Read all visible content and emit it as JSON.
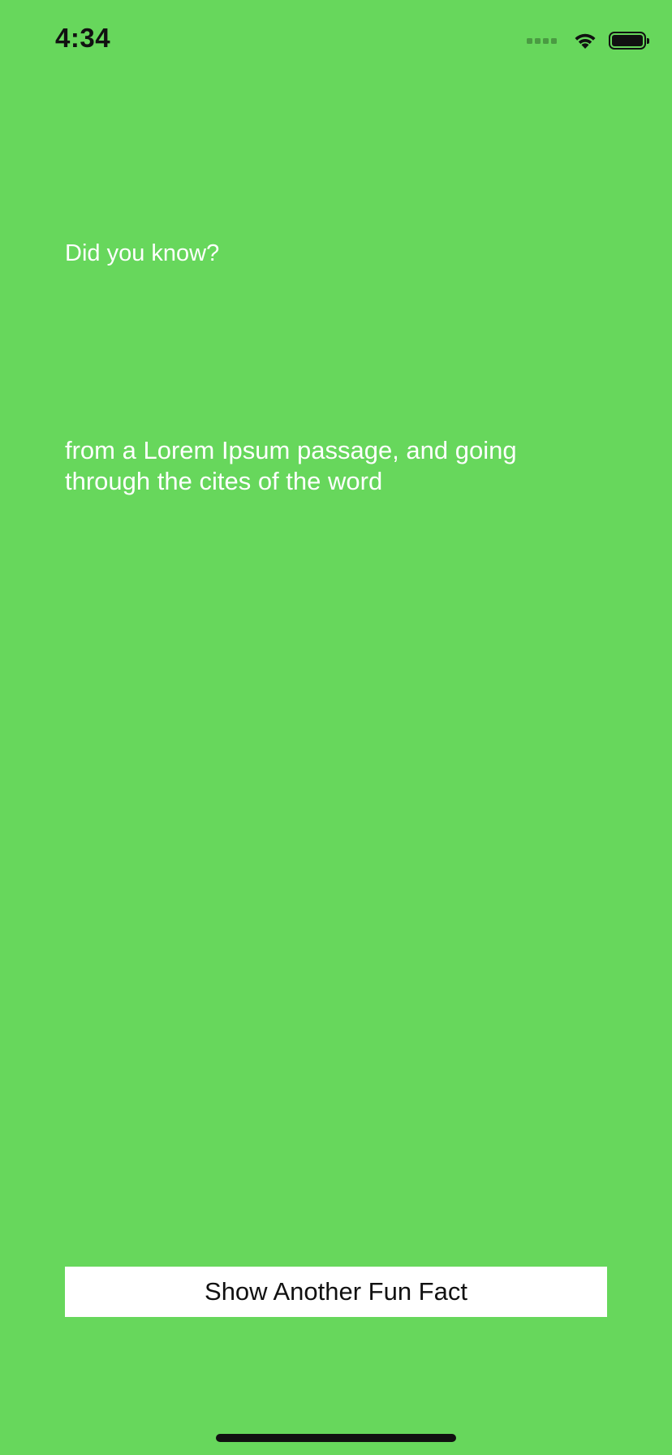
{
  "status_bar": {
    "time": "4:34",
    "icons": [
      "cellular-signal-icon",
      "wifi-icon",
      "battery-icon"
    ]
  },
  "main": {
    "heading": "Did you know?",
    "fact_text": "from a Lorem Ipsum passage, and going through the cites of the word",
    "button_label": "Show Another Fun Fact"
  },
  "colors": {
    "background": "#67d75c",
    "text": "#ffffff",
    "button_background": "#ffffff",
    "button_text": "#111111"
  }
}
